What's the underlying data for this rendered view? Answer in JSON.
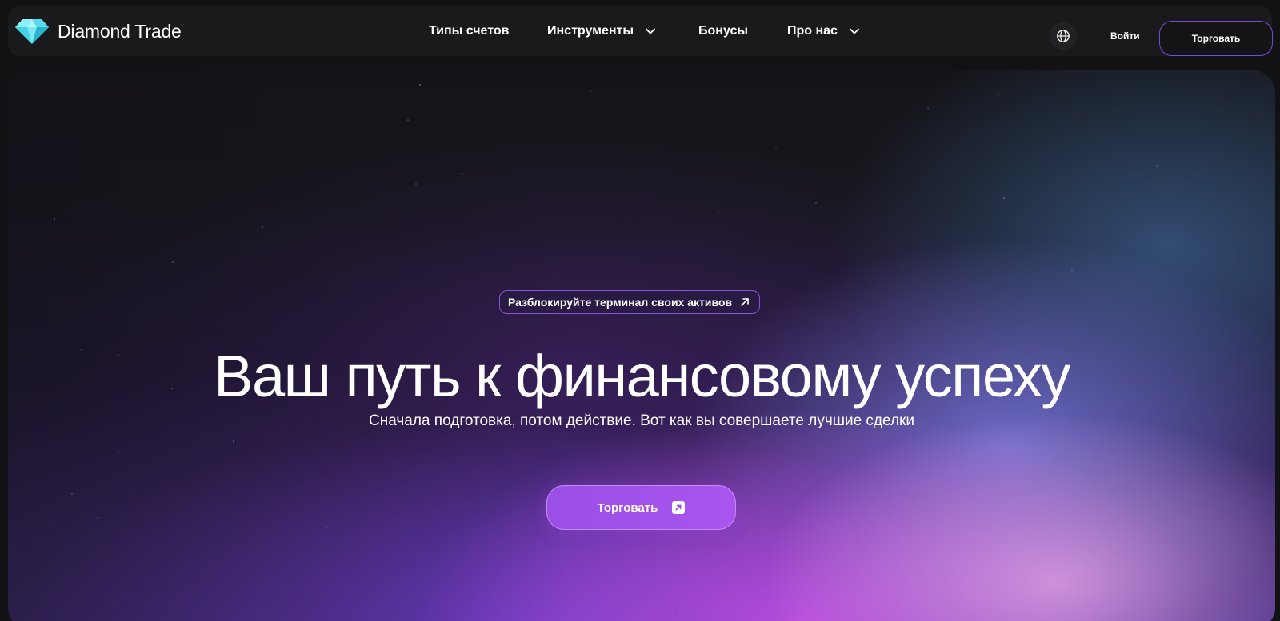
{
  "header": {
    "brand": "Diamond Trade",
    "logo_icon": "diamond-icon",
    "nav": [
      {
        "label": "Типы счетов",
        "has_dropdown": false
      },
      {
        "label": "Инструменты",
        "has_dropdown": true
      },
      {
        "label": "Бонусы",
        "has_dropdown": false
      },
      {
        "label": "Про нас",
        "has_dropdown": true
      }
    ],
    "language_icon": "globe-icon",
    "login_label": "Войти",
    "trade_label": "Торговать"
  },
  "hero": {
    "badge_label": "Разблокируйте терминал своих активов",
    "badge_icon": "arrow-up-right-icon",
    "title": "Ваш путь к финансовому успеху",
    "subtitle": "Сначала подготовка, потом действие. Вот как вы совершаете лучшие сделки",
    "cta_label": "Торговать",
    "cta_icon": "external-link-icon"
  },
  "colors": {
    "background": "#121214",
    "navbar": "#1a1a1c",
    "accent": "#a954ef",
    "accent_border": "#7a4ad6",
    "diamond": "#5fe3f0"
  }
}
